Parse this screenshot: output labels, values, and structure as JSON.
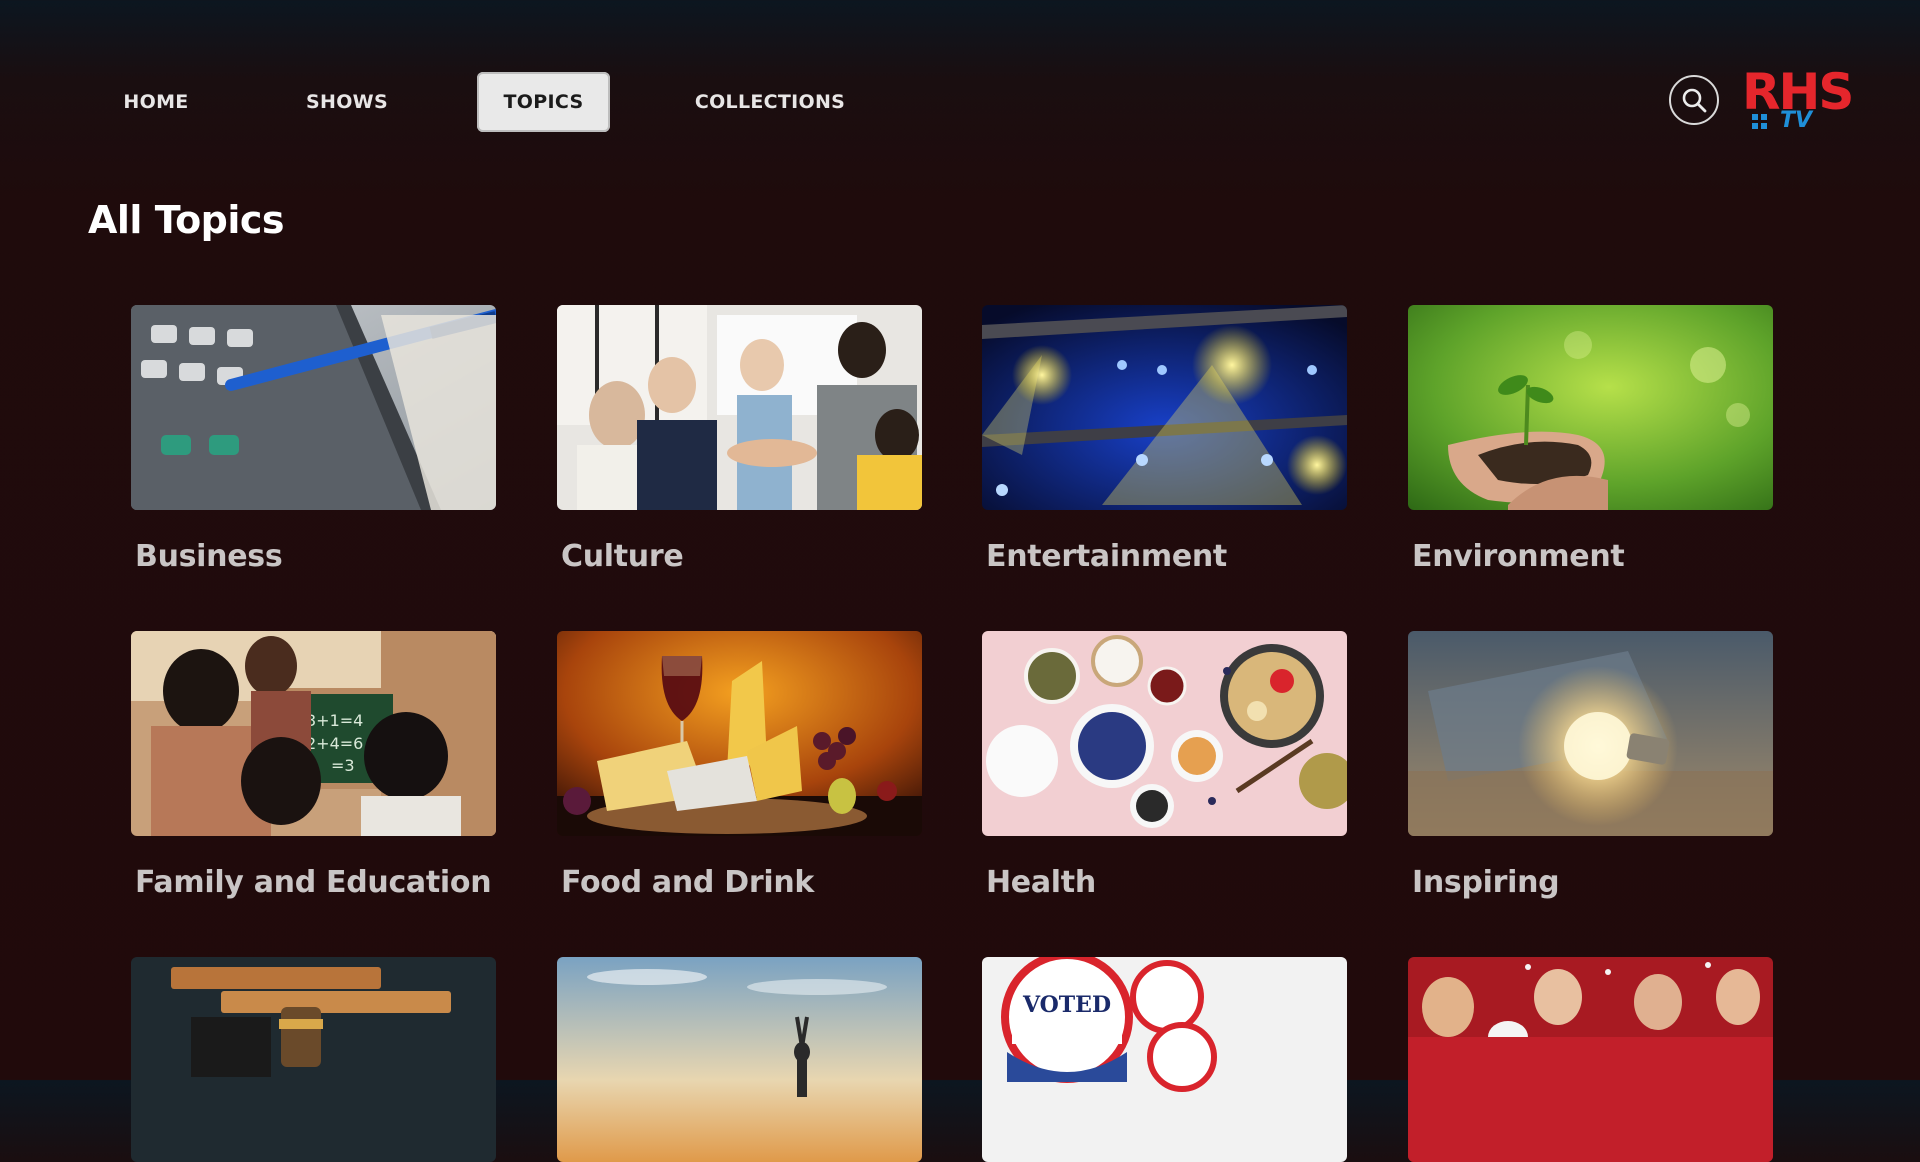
{
  "nav": {
    "items": [
      {
        "label": "HOME",
        "active": false
      },
      {
        "label": "SHOWS",
        "active": false
      },
      {
        "label": "TOPICS",
        "active": true
      },
      {
        "label": "COLLECTIONS",
        "active": false
      }
    ]
  },
  "header": {
    "search_icon": "search-icon",
    "logo": {
      "primary": "RHS",
      "secondary": "TV",
      "primary_color": "#e5262c",
      "secondary_color": "#1f8fd8"
    }
  },
  "main": {
    "title": "All Topics",
    "topics": [
      {
        "label": "Business",
        "image": "calculator-and-pen-on-money"
      },
      {
        "label": "Culture",
        "image": "team-hands-together"
      },
      {
        "label": "Entertainment",
        "image": "concert-stage-lights"
      },
      {
        "label": "Environment",
        "image": "seedling-in-hands"
      },
      {
        "label": "Family and Education",
        "image": "family-at-chalkboard"
      },
      {
        "label": "Food and Drink",
        "image": "wine-and-cheese"
      },
      {
        "label": "Health",
        "image": "healthy-food-bowls"
      },
      {
        "label": "Inspiring",
        "image": "glowing-light-bulb"
      },
      {
        "label": "",
        "image": "gavel-and-books"
      },
      {
        "label": "",
        "image": "yoga-silhouette-sunset"
      },
      {
        "label": "",
        "image": "i-voted-stickers"
      },
      {
        "label": "",
        "image": "crowd-celebration"
      }
    ]
  },
  "colors": {
    "background": "#210a0b",
    "active_tab_bg": "#e9e9e9",
    "label_text": "#c9c5c5"
  }
}
